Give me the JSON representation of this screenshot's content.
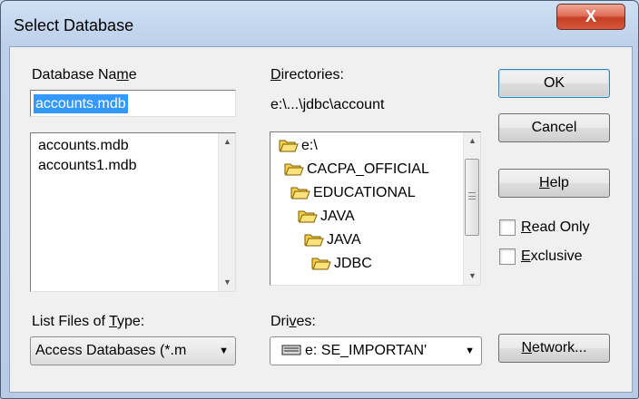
{
  "window": {
    "title": "Select Database",
    "close_glyph": "X"
  },
  "database_name": {
    "label_pre": "Database Na",
    "label_acc": "m",
    "label_post": "e",
    "value": "accounts.mdb",
    "files": [
      "accounts.mdb",
      "accounts1.mdb"
    ]
  },
  "directories": {
    "label_acc": "D",
    "label_post": "irectories:",
    "current_path": "e:\\...\\jdbc\\account",
    "items": [
      "e:\\",
      "CACPA_OFFICIAL",
      "EDUCATIONAL",
      "JAVA",
      "JAVA",
      "JDBC"
    ]
  },
  "buttons": {
    "ok": "OK",
    "cancel": "Cancel",
    "help_acc": "H",
    "help_post": "elp",
    "network_acc": "N",
    "network_post": "etwork..."
  },
  "options": {
    "read_only_acc": "R",
    "read_only_post": "ead Only",
    "exclusive_acc": "E",
    "exclusive_post": "xclusive"
  },
  "file_types": {
    "label_pre": "List Files of ",
    "label_acc": "T",
    "label_post": "ype:",
    "selected": "Access Databases (*.m"
  },
  "drives": {
    "label_pre": "Dri",
    "label_acc": "v",
    "label_post": "es:",
    "selected": "e: SE_IMPORTAN'"
  },
  "icons": [
    "folder-open-icon",
    "drive-icon",
    "dropdown-arrow-icon",
    "scroll-up-icon",
    "scroll-down-icon",
    "close-icon"
  ],
  "colors": {
    "selection": "#3399ff",
    "folder": "#f5d04a",
    "close_button": "#c53e26"
  }
}
